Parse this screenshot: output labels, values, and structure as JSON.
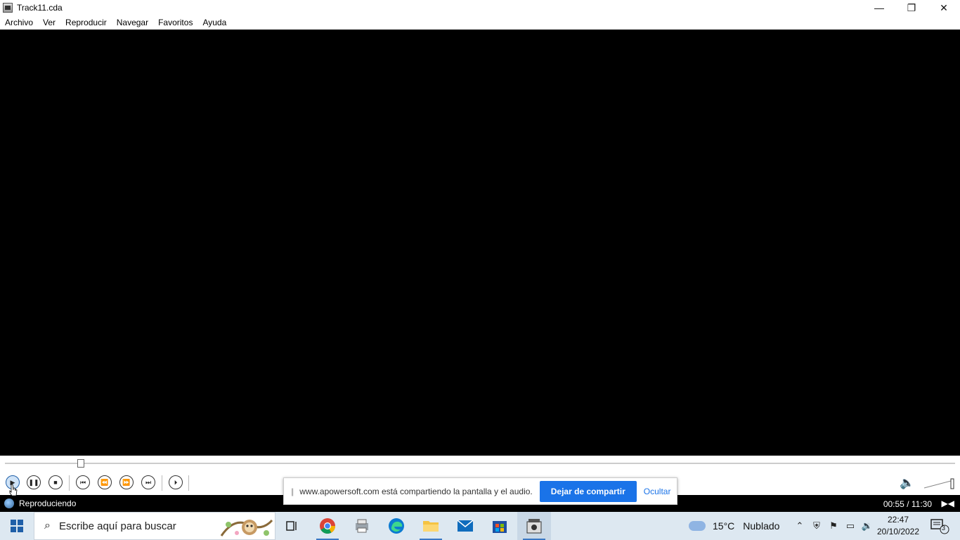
{
  "window": {
    "title": "Track11.cda",
    "controls": {
      "minimize": "—",
      "restore": "❐",
      "close": "✕"
    }
  },
  "menu": [
    "Archivo",
    "Ver",
    "Reproducir",
    "Navegar",
    "Favoritos",
    "Ayuda"
  ],
  "player": {
    "seek_fraction": 0.08,
    "buttons": [
      {
        "name": "play-icon",
        "glyph": "▶"
      },
      {
        "name": "pause-icon",
        "glyph": "❚❚"
      },
      {
        "name": "stop-icon",
        "glyph": "■"
      },
      {
        "name": "skip-back-icon",
        "glyph": "⏮"
      },
      {
        "name": "rewind-icon",
        "glyph": "⏪"
      },
      {
        "name": "fast-forward-icon",
        "glyph": "⏩"
      },
      {
        "name": "skip-forward-icon",
        "glyph": "⏭"
      },
      {
        "name": "frame-step-icon",
        "glyph": "⏵"
      }
    ],
    "volume_glyph": "🔈",
    "status": "Reproduciendo",
    "time": "00:55 / 11:30"
  },
  "share_bar": {
    "grip": "||",
    "message": "www.apowersoft.com está compartiendo la pantalla y el audio.",
    "stop_label": "Dejar de compartir",
    "hide_label": "Ocultar"
  },
  "taskbar": {
    "search_placeholder": "Escribe aquí para buscar",
    "apps": [
      "task-view",
      "chrome",
      "printer-app",
      "edge",
      "file-explorer",
      "mail",
      "store",
      "media-player"
    ],
    "weather_temp": "15°C",
    "weather_text": "Nublado",
    "clock_time": "22:47",
    "clock_date": "20/10/2022",
    "notifications_count": "3"
  },
  "colors": {
    "accent": "#1a73e8",
    "taskbar_bg": "#dde8f1"
  }
}
